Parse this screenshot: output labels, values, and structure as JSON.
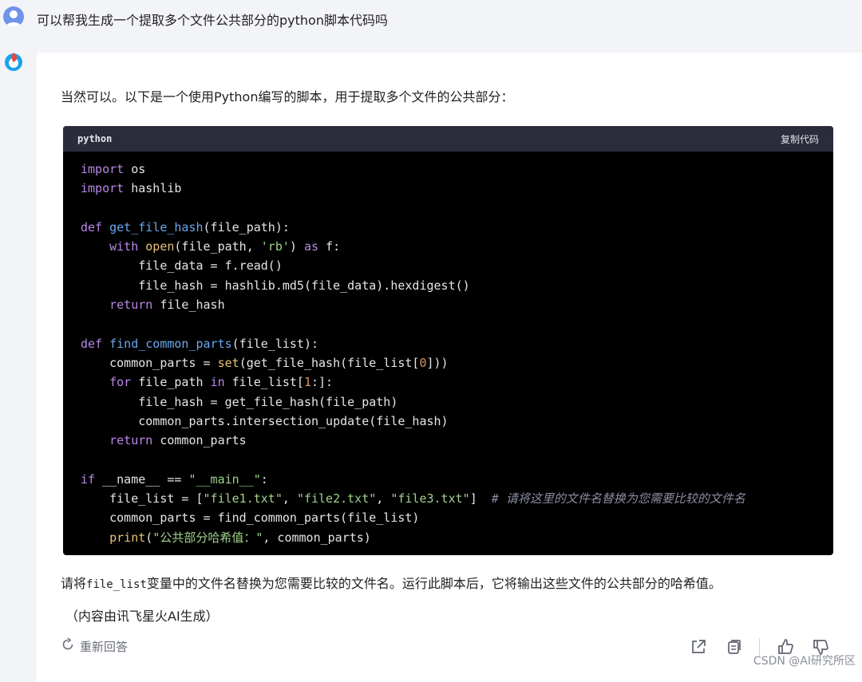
{
  "user": {
    "avatar_icon": "user-avatar-icon",
    "message": "可以帮我生成一个提取多个文件公共部分的python脚本代码吗"
  },
  "assistant": {
    "avatar_icon": "spark-logo-icon",
    "intro": "当然可以。以下是一个使用Python编写的脚本，用于提取多个文件的公共部分：",
    "code": {
      "language": "python",
      "copy_label": "复制代码",
      "lines": [
        "import os",
        "import hashlib",
        "",
        "def get_file_hash(file_path):",
        "    with open(file_path, 'rb') as f:",
        "        file_data = f.read()",
        "        file_hash = hashlib.md5(file_data).hexdigest()",
        "    return file_hash",
        "",
        "def find_common_parts(file_list):",
        "    common_parts = set(get_file_hash(file_list[0]))",
        "    for file_path in file_list[1:]:",
        "        file_hash = get_file_hash(file_path)",
        "        common_parts.intersection_update(file_hash)",
        "    return common_parts",
        "",
        "if __name__ == \"__main__\":",
        "    file_list = [\"file1.txt\", \"file2.txt\", \"file3.txt\"]  # 请将这里的文件名替换为您需要比较的文件名",
        "    common_parts = find_common_parts(file_list)",
        "    print(\"公共部分哈希值：\", common_parts)"
      ]
    },
    "after_text_before_code": "请将",
    "after_text_code": "file_list",
    "after_text_after_code": "变量中的文件名替换为您需要比较的文件名。运行此脚本后，它将输出这些文件的公共部分的哈希值。",
    "source_note": "（内容由讯飞星火AI生成）",
    "regenerate_label": "重新回答"
  },
  "watermark_bottom": "CSDN @AI研究所区",
  "colors": {
    "page_bg": "#f3f4f8",
    "card_bg": "#ffffff",
    "code_bg": "#000000",
    "code_header_bg": "#2b2c3a"
  }
}
